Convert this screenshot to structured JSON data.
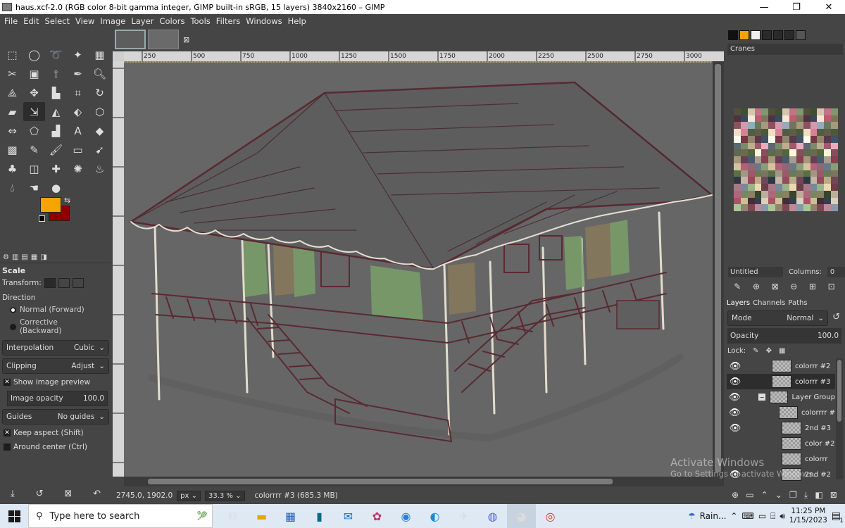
{
  "window": {
    "title": "haus.xcf-2.0 (RGB color 8-bit gamma integer, GIMP built-in sRGB, 15 layers) 3840x2160 – GIMP"
  },
  "menu": [
    "File",
    "Edit",
    "Select",
    "View",
    "Image",
    "Layer",
    "Colors",
    "Tools",
    "Filters",
    "Windows",
    "Help"
  ],
  "rulers": {
    "h_ticks": [
      "250",
      "500",
      "750",
      "1000",
      "1250",
      "1500",
      "1750",
      "2000",
      "2250",
      "2500",
      "2750",
      "3000"
    ]
  },
  "tool_options": {
    "title": "Scale",
    "transform_label": "Transform:",
    "direction_label": "Direction",
    "direction_forward": "Normal (Forward)",
    "direction_backward": "Corrective (Backward)",
    "interpolation_label": "Interpolation",
    "interpolation_value": "Cubic",
    "clipping_label": "Clipping",
    "clipping_value": "Adjust",
    "show_preview": "Show image preview",
    "image_opacity_label": "Image opacity",
    "image_opacity_value": "100.0",
    "guides_label": "Guides",
    "guides_value": "No guides",
    "keep_aspect": "Keep aspect (Shift)",
    "around_center": "Around center (Ctrl)"
  },
  "status": {
    "coords": "2745.0, 1902.0",
    "unit": "px",
    "zoom": "33.3 %",
    "layer_info": "colorrrr #3 (685.3 MB)"
  },
  "palette": {
    "name": "Cranes",
    "grid_name": "Untitled",
    "columns_label": "Columns:",
    "columns_value": "0"
  },
  "layers_dock": {
    "tabs": [
      "Layers",
      "Channels",
      "Paths"
    ],
    "mode_label": "Mode",
    "mode_value": "Normal",
    "opacity_label": "Opacity",
    "opacity_value": "100.0",
    "lock_label": "Lock:",
    "layers": [
      {
        "name": "colorrr #2"
      },
      {
        "name": "colorrr #3"
      },
      {
        "name": "Layer Group"
      },
      {
        "name": "colorrrr #"
      },
      {
        "name": "2nd #3"
      },
      {
        "name": "color #2"
      },
      {
        "name": "colorrr"
      },
      {
        "name": "2nd #2"
      }
    ]
  },
  "watermark": {
    "line1": "Activate Windows",
    "line2": "Go to Settings to activate Windows."
  },
  "taskbar": {
    "search_placeholder": "Type here to search",
    "weather": "Rain...",
    "time": "11:25 PM",
    "date": "1/15/2023",
    "notifications": "1"
  },
  "colors": {
    "foreground": "#f5a400",
    "background": "#8e0000"
  }
}
